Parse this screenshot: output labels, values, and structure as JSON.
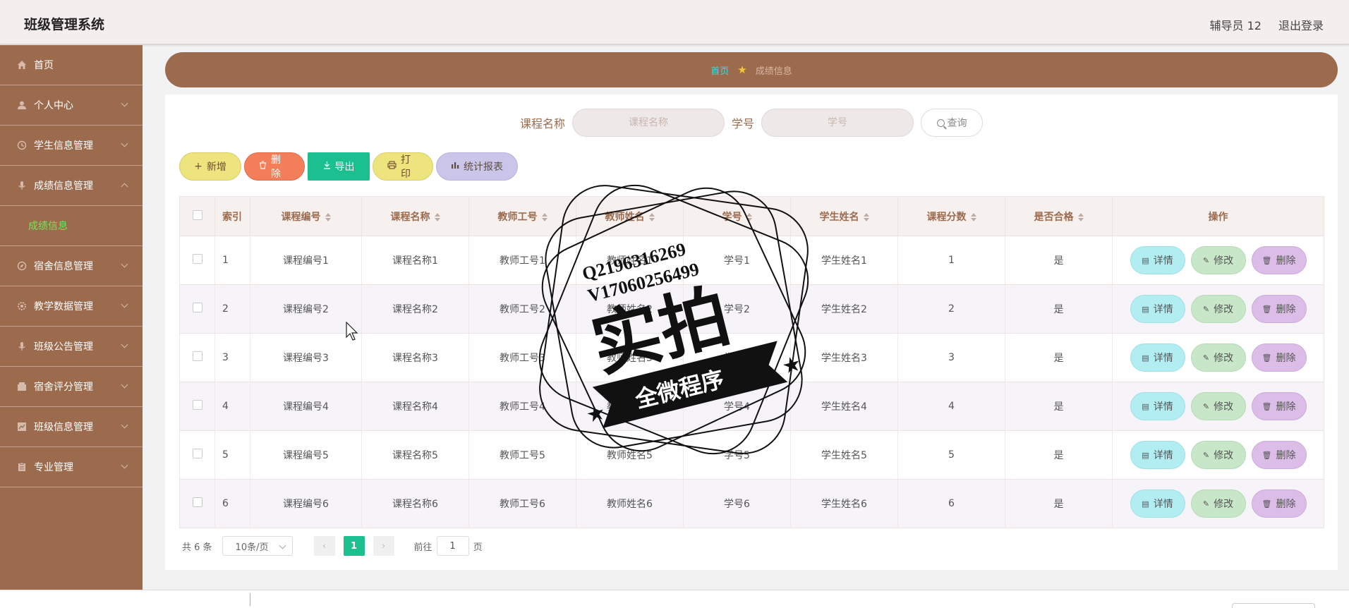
{
  "header": {
    "app_title": "班级管理系统",
    "user_label": "辅导员 12",
    "logout_label": "退出登录"
  },
  "sidebar": {
    "items": [
      {
        "label": "首页",
        "icon": "home-icon"
      },
      {
        "label": "个人中心",
        "icon": "user-icon"
      },
      {
        "label": "学生信息管理",
        "icon": "clock-icon"
      },
      {
        "label": "成绩信息管理",
        "icon": "mic-icon",
        "expanded": true
      },
      {
        "label": "宿舍信息管理",
        "icon": "compass-icon"
      },
      {
        "label": "教学数据管理",
        "icon": "gear-icon"
      },
      {
        "label": "班级公告管理",
        "icon": "mic-icon"
      },
      {
        "label": "宿舍评分管理",
        "icon": "box-icon"
      },
      {
        "label": "班级信息管理",
        "icon": "chart-icon"
      },
      {
        "label": "专业管理",
        "icon": "clipboard-icon"
      }
    ],
    "active_sub": "成绩信息"
  },
  "breadcrumb": {
    "home": "首页",
    "current": "成绩信息"
  },
  "search": {
    "course_name_label": "课程名称",
    "course_name_placeholder": "课程名称",
    "student_no_label": "学号",
    "student_no_placeholder": "学号",
    "query_label": "查询"
  },
  "toolbar": {
    "add": "新增",
    "delete": "删除",
    "export": "导出",
    "print": "打印",
    "stats": "统计报表"
  },
  "table": {
    "columns": [
      "索引",
      "课程编号",
      "课程名称",
      "教师工号",
      "教师姓名",
      "学号",
      "学生姓名",
      "课程分数",
      "是否合格",
      "操作"
    ],
    "rows": [
      {
        "index": "1",
        "course_no": "课程编号1",
        "course_name": "课程名称1",
        "teacher_no": "教师工号1",
        "teacher_name": "教师姓名1",
        "student_no": "学号1",
        "student_name": "学生姓名1",
        "score": "1",
        "pass": "是"
      },
      {
        "index": "2",
        "course_no": "课程编号2",
        "course_name": "课程名称2",
        "teacher_no": "教师工号2",
        "teacher_name": "教师姓名2",
        "student_no": "学号2",
        "student_name": "学生姓名2",
        "score": "2",
        "pass": "是"
      },
      {
        "index": "3",
        "course_no": "课程编号3",
        "course_name": "课程名称3",
        "teacher_no": "教师工号3",
        "teacher_name": "教师姓名3",
        "student_no": "学号3",
        "student_name": "学生姓名3",
        "score": "3",
        "pass": "是"
      },
      {
        "index": "4",
        "course_no": "课程编号4",
        "course_name": "课程名称4",
        "teacher_no": "教师工号4",
        "teacher_name": "教师姓名4",
        "student_no": "学号4",
        "student_name": "学生姓名4",
        "score": "4",
        "pass": "是"
      },
      {
        "index": "5",
        "course_no": "课程编号5",
        "course_name": "课程名称5",
        "teacher_no": "教师工号5",
        "teacher_name": "教师姓名5",
        "student_no": "学号5",
        "student_name": "学生姓名5",
        "score": "5",
        "pass": "是"
      },
      {
        "index": "6",
        "course_no": "课程编号6",
        "course_name": "课程名称6",
        "teacher_no": "教师工号6",
        "teacher_name": "教师姓名6",
        "student_no": "学号6",
        "student_name": "学生姓名6",
        "score": "6",
        "pass": "是"
      }
    ],
    "actions": {
      "detail": "详情",
      "edit": "修改",
      "delete": "删除"
    }
  },
  "pagination": {
    "total": "共 6 条",
    "page_size": "10条/页",
    "current_page": "1",
    "goto_label": "前往",
    "goto_value": "1",
    "page_suffix": "页"
  },
  "watermark": {
    "line1": "Q2196316269",
    "line2": "V17060256499",
    "main": "实拍",
    "banner": "全微程序"
  },
  "colors": {
    "sidebar": "#9c6b4e",
    "accent_green": "#1cbf8f",
    "breadcrumb_home": "#4ad4e0"
  }
}
